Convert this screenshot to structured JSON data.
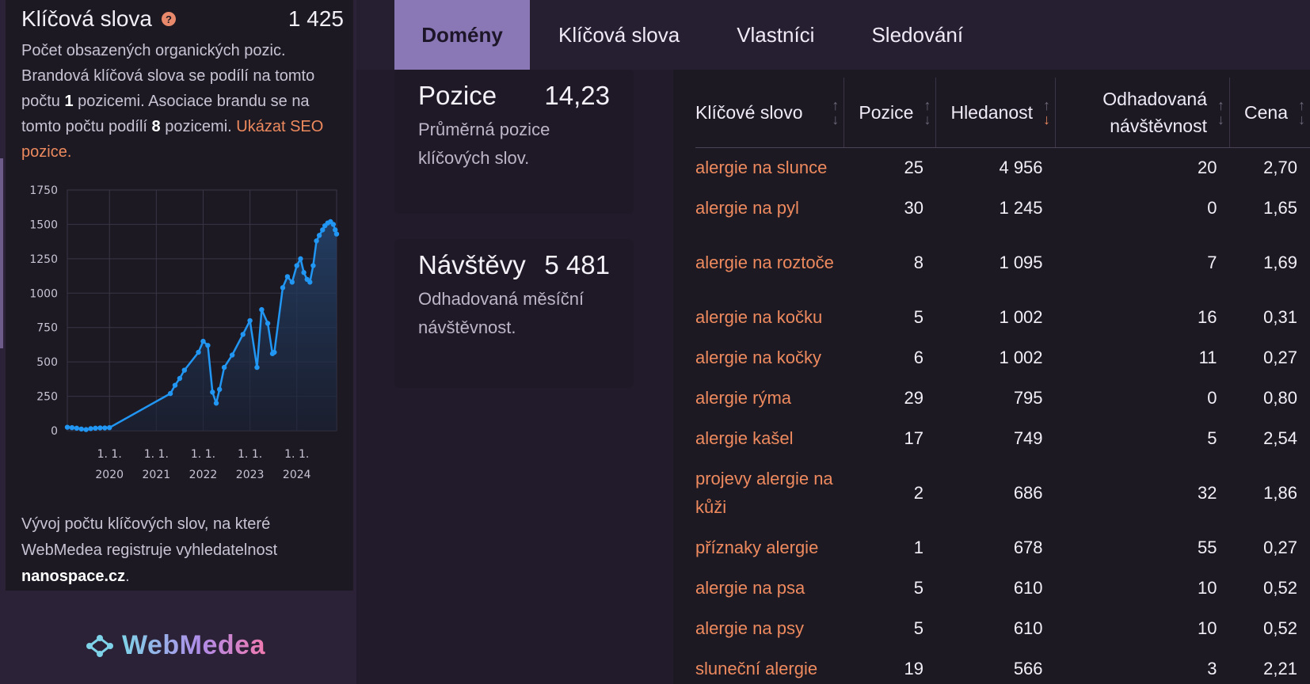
{
  "keywords_card": {
    "title": "Klíčová slova",
    "count": "1 425",
    "desc_1": "Počet obsazených organických pozic. Brandová klíčová slova se podílí na tomto počtu ",
    "desc_brand_num": "1",
    "desc_2": " pozicemi. Asociace brandu se na tomto počtu podílí ",
    "desc_assoc_num": "8",
    "desc_3": " pozicemi. ",
    "desc_link": "Ukázat SEO pozice.",
    "footer_1": "Vývoj počtu klíčových slov, na které WebMedea registruje vyhledatelnost ",
    "footer_domain": "nanospace.cz",
    "footer_2": "."
  },
  "chart_data": {
    "type": "area",
    "y_ticks": [
      "0",
      "250",
      "500",
      "750",
      "1000",
      "1250",
      "1500",
      "1750"
    ],
    "ylim": [
      0,
      1750
    ],
    "x_ticks": [
      {
        "day": "1. 1.",
        "year": "2020"
      },
      {
        "day": "1. 1.",
        "year": "2021"
      },
      {
        "day": "1. 1.",
        "year": "2022"
      },
      {
        "day": "1. 1.",
        "year": "2023"
      },
      {
        "day": "1. 1.",
        "year": "2024"
      }
    ],
    "x_range": [
      2019.1,
      2024.85
    ],
    "grid": true,
    "color": "#2196f3",
    "points": [
      [
        2019.1,
        25
      ],
      [
        2019.2,
        22
      ],
      [
        2019.3,
        18
      ],
      [
        2019.4,
        12
      ],
      [
        2019.5,
        8
      ],
      [
        2019.6,
        15
      ],
      [
        2019.7,
        18
      ],
      [
        2019.8,
        20
      ],
      [
        2019.9,
        20
      ],
      [
        2020.0,
        22
      ],
      [
        2021.3,
        270
      ],
      [
        2021.4,
        330
      ],
      [
        2021.5,
        380
      ],
      [
        2021.6,
        440
      ],
      [
        2021.9,
        570
      ],
      [
        2022.0,
        650
      ],
      [
        2022.1,
        620
      ],
      [
        2022.2,
        280
      ],
      [
        2022.28,
        200
      ],
      [
        2022.35,
        300
      ],
      [
        2022.45,
        460
      ],
      [
        2022.62,
        550
      ],
      [
        2022.85,
        700
      ],
      [
        2023.0,
        800
      ],
      [
        2023.15,
        460
      ],
      [
        2023.25,
        880
      ],
      [
        2023.38,
        780
      ],
      [
        2023.48,
        560
      ],
      [
        2023.52,
        570
      ],
      [
        2023.7,
        1040
      ],
      [
        2023.8,
        1120
      ],
      [
        2023.9,
        1080
      ],
      [
        2024.0,
        1200
      ],
      [
        2024.08,
        1250
      ],
      [
        2024.15,
        1150
      ],
      [
        2024.22,
        1100
      ],
      [
        2024.28,
        1080
      ],
      [
        2024.35,
        1200
      ],
      [
        2024.42,
        1380
      ],
      [
        2024.48,
        1420
      ],
      [
        2024.55,
        1460
      ],
      [
        2024.6,
        1490
      ],
      [
        2024.66,
        1510
      ],
      [
        2024.72,
        1520
      ],
      [
        2024.78,
        1500
      ],
      [
        2024.82,
        1460
      ],
      [
        2024.85,
        1430
      ]
    ]
  },
  "logo": {
    "text": "WebMedea"
  },
  "tabs": [
    {
      "label": "Domény",
      "active": true
    },
    {
      "label": "Klíčová slova",
      "active": false
    },
    {
      "label": "Vlastníci",
      "active": false
    },
    {
      "label": "Sledování",
      "active": false
    }
  ],
  "position_card": {
    "label": "Pozice",
    "value": "14,23",
    "desc": "Průměrná pozice klíčových slov."
  },
  "visits_card": {
    "label": "Návštěvy",
    "value": "5 481",
    "desc": "Odhadovaná měsíční návštěvnost."
  },
  "table": {
    "headers": [
      "Klíčové slovo",
      "Pozice",
      "Hledanost",
      "Odhadovaná návštěvnost",
      "Cena"
    ],
    "rows": [
      {
        "kw": "alergie na slunce",
        "pos": "25",
        "search": "4 956",
        "visits": "20",
        "price": "2,70"
      },
      {
        "kw": "alergie na pyl",
        "pos": "30",
        "search": "1 245",
        "visits": "0",
        "price": "1,65"
      },
      {
        "kw": "alergie na roztoče",
        "pos": "8",
        "search": "1 095",
        "visits": "7",
        "price": "1,69"
      },
      {
        "kw": "alergie na kočku",
        "pos": "5",
        "search": "1 002",
        "visits": "16",
        "price": "0,31"
      },
      {
        "kw": "alergie na kočky",
        "pos": "6",
        "search": "1 002",
        "visits": "11",
        "price": "0,27"
      },
      {
        "kw": "alergie rýma",
        "pos": "29",
        "search": "795",
        "visits": "0",
        "price": "0,80"
      },
      {
        "kw": "alergie kašel",
        "pos": "17",
        "search": "749",
        "visits": "5",
        "price": "2,54"
      },
      {
        "kw": "projevy alergie na kůži",
        "pos": "2",
        "search": "686",
        "visits": "32",
        "price": "1,86"
      },
      {
        "kw": "příznaky alergie",
        "pos": "1",
        "search": "678",
        "visits": "55",
        "price": "0,27"
      },
      {
        "kw": "alergie na psa",
        "pos": "5",
        "search": "610",
        "visits": "10",
        "price": "0,52"
      },
      {
        "kw": "alergie na psy",
        "pos": "5",
        "search": "610",
        "visits": "10",
        "price": "0,52"
      },
      {
        "kw": "sluneční alergie",
        "pos": "19",
        "search": "566",
        "visits": "3",
        "price": "2,21"
      }
    ]
  }
}
